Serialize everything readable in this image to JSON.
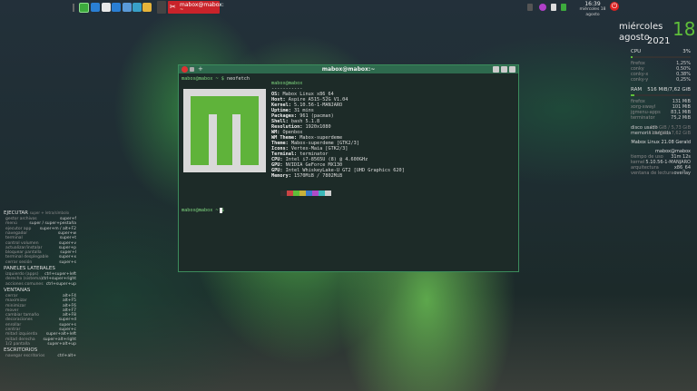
{
  "taskbar": {
    "task_title": "mabox@mabox:",
    "task_sub": "~",
    "clock_time": "16:39",
    "clock_date": "miércoles 18 agosto",
    "colors": {
      "task_bg": "#c9232a",
      "accent": "#3daa3d"
    }
  },
  "conky": {
    "day_name": "miércoles",
    "month": "agosto",
    "year": "2021",
    "day_number": "18",
    "cpu_label": "CPU",
    "cpu_value": "3%",
    "cpu_fraction": 0.03,
    "processes": [
      {
        "name": "firefox",
        "value": "1,25%"
      },
      {
        "name": "conky",
        "value": "0,50%"
      },
      {
        "name": "conky-x",
        "value": "0,38%"
      },
      {
        "name": "conky-y",
        "value": "0,25%"
      }
    ],
    "ram_label": "RAM",
    "ram_value": "516 MiB/7,62 GiB",
    "ram_fraction": 0.066,
    "mem_processes": [
      {
        "name": "firefox",
        "value": "131 MiB"
      },
      {
        "name": "xorg-xwayl",
        "value": "101 MiB"
      },
      {
        "name": "jgmenu-apps",
        "value": "83,1 MiB"
      },
      {
        "name": "terminator",
        "value": "75,2 MiB"
      }
    ],
    "disk_used_label": "disco usado",
    "disk_used_value": "8,5 GiB / 5,73 GiB",
    "mem_load_label": "memoria cargada",
    "mem_load_value": "516 MiB / 7,62 GiB",
    "os_line": "Mabox Linux 21.08 Gerald",
    "user_host": "mabox@mabox",
    "uptime_label": "tiempo de uso",
    "uptime_value": "31m 12s",
    "kernel_label": "kernel",
    "kernel_value": "5.10.56-1-MANJARO",
    "arch_label": "arquitectura",
    "arch_value": "x86_64",
    "wm_label": "ventana de lectura",
    "wm_value": "overlay"
  },
  "keybinds": {
    "sections": [
      {
        "title": "EJECUTAR",
        "subtitle": "super + letra/símbolo",
        "rows": [
          {
            "a": "gestor archivos",
            "b": "super+f"
          },
          {
            "a": "menú",
            "b": "super / super+pestaña"
          },
          {
            "a": "ejecutor app",
            "b": "super+m / alt+F2"
          },
          {
            "a": "navegador",
            "b": "super+w"
          },
          {
            "a": "terminal",
            "b": "super+t"
          },
          {
            "a": "control volumen",
            "b": "super+v"
          },
          {
            "a": "actualizar/instalar",
            "b": "super+p"
          },
          {
            "a": "bloquear pantalla",
            "b": "super+l"
          },
          {
            "a": "terminal desplegable",
            "b": "super+x"
          },
          {
            "a": "cerrar sesión",
            "b": "super+s"
          }
        ]
      },
      {
        "title": "PANELES LATERALES",
        "subtitle": "",
        "rows": [
          {
            "a": "izquierdo (apps)",
            "b": "ctrl+super+left"
          },
          {
            "a": "derecho (sistema)",
            "b": "ctrl+super+right"
          },
          {
            "a": "acciones comunes",
            "b": "ctrl+super+up"
          }
        ]
      },
      {
        "title": "VENTANAS",
        "subtitle": "",
        "rows": [
          {
            "a": "cerrar",
            "b": "alt+F4"
          },
          {
            "a": "maximizar",
            "b": "alt+F5"
          },
          {
            "a": "minimizar",
            "b": "alt+F6"
          },
          {
            "a": "mover",
            "b": "alt+F7"
          },
          {
            "a": "cambiar tamaño",
            "b": "alt+F8"
          },
          {
            "a": "decoraciones",
            "b": "super+d"
          },
          {
            "a": "enrollar",
            "b": "super+s"
          },
          {
            "a": "centrar",
            "b": "super+c"
          },
          {
            "a": "mitad izquierda",
            "b": "super+alt+left"
          },
          {
            "a": "mitad derecha",
            "b": "super+alt+right"
          },
          {
            "a": "1/2 pantalla",
            "b": "super+alt+up"
          }
        ]
      },
      {
        "title": "ESCRITORIOS",
        "subtitle": "",
        "rows": [
          {
            "a": "navegar escritorios",
            "b": "ctrl+alt+"
          }
        ]
      }
    ]
  },
  "terminal": {
    "title": "mabox@mabox:~",
    "prompt": "mabox@mabox ~ $",
    "command": "neofetch",
    "header": "mabox@mabox",
    "separator": "-----------",
    "info": [
      {
        "k": "OS:",
        "v": "Mabox Linux x86_64"
      },
      {
        "k": "Host:",
        "v": "Aspire A515-52G V1.04"
      },
      {
        "k": "Kernel:",
        "v": "5.10.56-1-MANJARO"
      },
      {
        "k": "Uptime:",
        "v": "31 mins"
      },
      {
        "k": "Packages:",
        "v": "961 (pacman)"
      },
      {
        "k": "Shell:",
        "v": "bash 5.1.8"
      },
      {
        "k": "Resolution:",
        "v": "1920x1080"
      },
      {
        "k": "WM:",
        "v": "Openbox"
      },
      {
        "k": "WM Theme:",
        "v": "Mabox-superdeme"
      },
      {
        "k": "Theme:",
        "v": "Mabox-superdeme [GTK2/3]"
      },
      {
        "k": "Icons:",
        "v": "Vertex-Maia [GTK2/3]"
      },
      {
        "k": "Terminal:",
        "v": "terminator"
      },
      {
        "k": "CPU:",
        "v": "Intel i7-8565U (8) @ 4.600GHz"
      },
      {
        "k": "GPU:",
        "v": "NVIDIA GeForce MX130"
      },
      {
        "k": "GPU:",
        "v": "Intel WhiskeyLake-U GT2 [UHD Graphics 620]"
      },
      {
        "k": "Memory:",
        "v": "1570MiB / 7802MiB"
      }
    ],
    "palette": [
      "#2e2e2e",
      "#cc4444",
      "#5fbf3a",
      "#c8b23a",
      "#3a7acc",
      "#b04ac8",
      "#3ab8b8",
      "#cfcfcf"
    ],
    "bg_color": "#1d2b28",
    "title_color": "#2e6a4e"
  }
}
